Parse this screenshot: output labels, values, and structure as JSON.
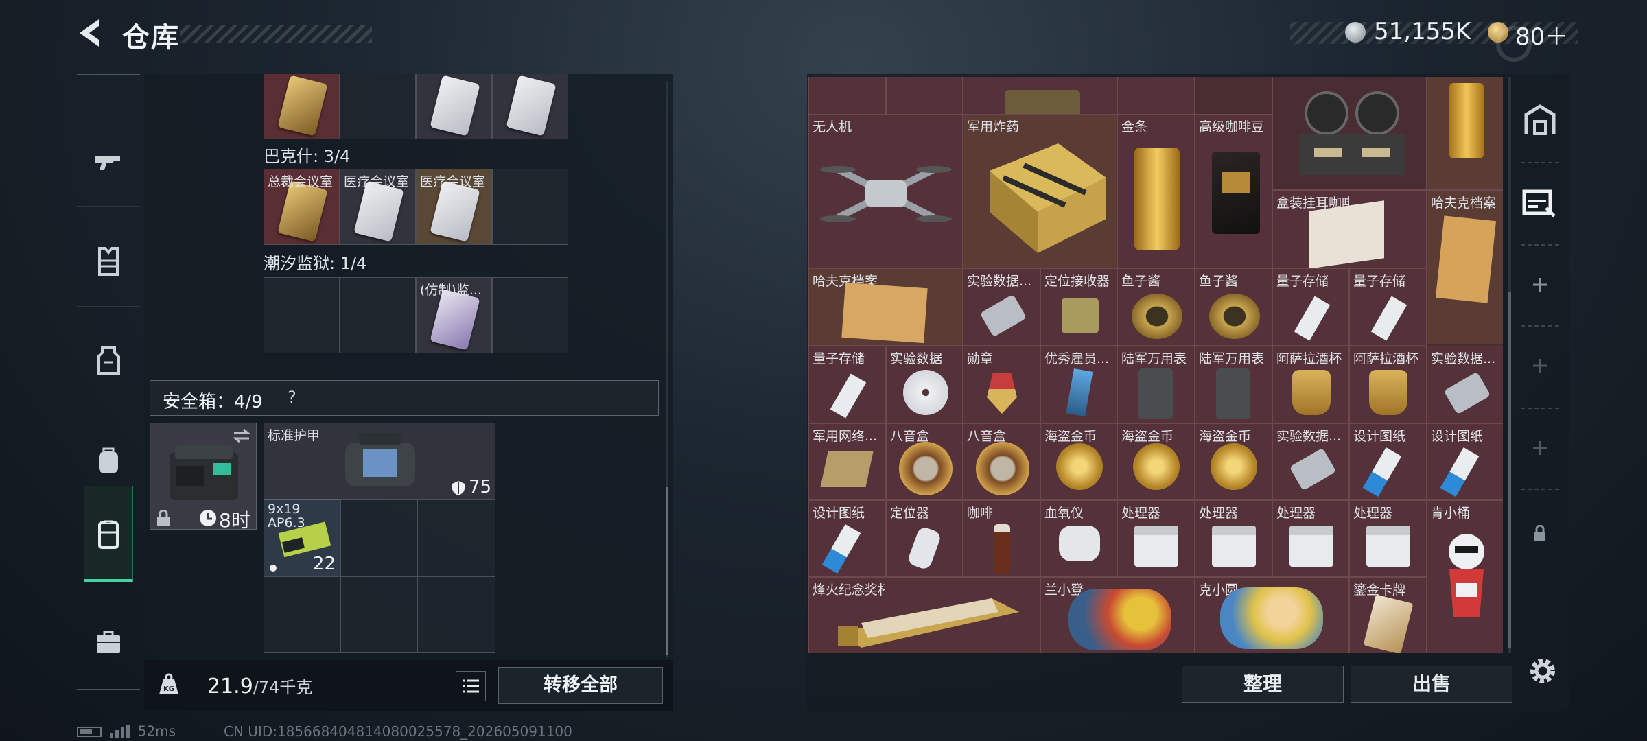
{
  "header": {
    "title": "仓库",
    "currency_silver": "51,155K",
    "currency_gold": "80＋",
    "colors": {
      "silver": "#b9c0c6",
      "gold": "#d8a545"
    }
  },
  "left_rail": {
    "items": [
      {
        "name": "weapon-icon"
      },
      {
        "name": "vest-icon"
      },
      {
        "name": "armor-icon"
      },
      {
        "name": "backpack-icon"
      },
      {
        "name": "keycard-icon",
        "active": true
      },
      {
        "name": "briefcase-icon"
      }
    ]
  },
  "keys": {
    "top_row": [
      "",
      "",
      "",
      ""
    ],
    "group1_label": "巴克什: 3/4",
    "group1": [
      "总裁会议室",
      "医疗会议室",
      "医疗会议室",
      ""
    ],
    "group2_label": "潮汐监狱: 1/4",
    "group2": [
      "",
      "",
      "(仿制)监...",
      ""
    ]
  },
  "safe": {
    "label": "安全箱：4/9",
    "help": "?",
    "timer": "8时",
    "armor_name": "标准护甲",
    "armor_value": "75",
    "ammo_name": "9x19 AP6.3",
    "ammo_qty": "22"
  },
  "bottom_left": {
    "weight": "21.9",
    "weight_max": "/74千克",
    "transfer_label": "转移全部"
  },
  "stash": {
    "top_row": [
      "",
      "",
      "",
      ""
    ],
    "items": [
      {
        "label": "无人机"
      },
      {
        "label": "军用炸药"
      },
      {
        "label": "金条"
      },
      {
        "label": "高级咖啡豆"
      },
      {
        "label": ""
      },
      {
        "label": ""
      },
      {
        "label": "盒装挂耳咖啡"
      },
      {
        "label": "哈夫克档案"
      },
      {
        "label": "哈夫克档案"
      },
      {
        "label": "实验数据..."
      },
      {
        "label": "定位接收器"
      },
      {
        "label": "鱼子酱"
      },
      {
        "label": "鱼子酱"
      },
      {
        "label": "量子存储"
      },
      {
        "label": "量子存储"
      },
      {
        "label": "量子存储"
      },
      {
        "label": "实验数据"
      },
      {
        "label": "勋章"
      },
      {
        "label": "优秀雇员..."
      },
      {
        "label": "陆军万用表"
      },
      {
        "label": "陆军万用表"
      },
      {
        "label": "阿萨拉酒杯"
      },
      {
        "label": "阿萨拉酒杯"
      },
      {
        "label": "实验数据..."
      },
      {
        "label": "军用网络..."
      },
      {
        "label": "八音盒"
      },
      {
        "label": "八音盒"
      },
      {
        "label": "海盗金币"
      },
      {
        "label": "海盗金币"
      },
      {
        "label": "海盗金币"
      },
      {
        "label": "实验数据..."
      },
      {
        "label": "设计图纸"
      },
      {
        "label": "设计图纸"
      },
      {
        "label": "设计图纸"
      },
      {
        "label": "定位器"
      },
      {
        "label": "咖啡"
      },
      {
        "label": "血氧仪"
      },
      {
        "label": "处理器"
      },
      {
        "label": "处理器"
      },
      {
        "label": "处理器"
      },
      {
        "label": "处理器"
      },
      {
        "label": "肯小桶"
      },
      {
        "label": "烽火纪念奖杯"
      },
      {
        "label": "兰小登"
      },
      {
        "label": "克小圆"
      },
      {
        "label": "鎏金卡牌"
      }
    ],
    "organize_label": "整理",
    "sell_label": "出售"
  },
  "right_rail": {
    "items": [
      {
        "name": "storage-icon"
      },
      {
        "name": "storage-expand-icon"
      },
      {
        "name": "plus-icon"
      },
      {
        "name": "plus-icon"
      },
      {
        "name": "plus-icon"
      },
      {
        "name": "lock-icon"
      }
    ]
  },
  "status": {
    "ping": "52ms",
    "uid": "CN UID:18566840481408002557‌8_202605091100"
  }
}
